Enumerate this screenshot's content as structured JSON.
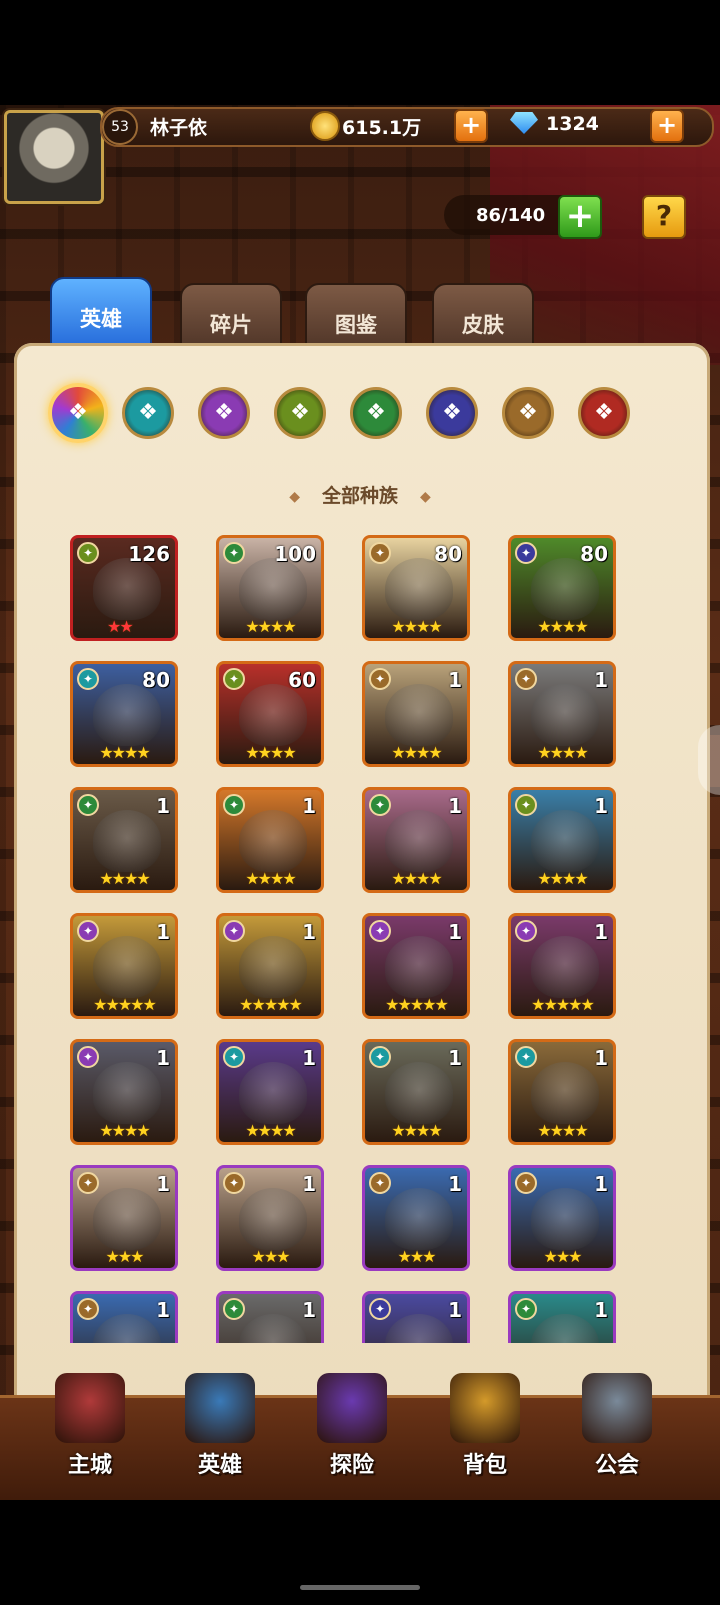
{
  "player": {
    "level": "53",
    "name": "林子依",
    "gold": "615.1万",
    "gems": "1324"
  },
  "hero_capacity": "86/140",
  "tabs": [
    {
      "label": "英雄",
      "active": true
    },
    {
      "label": "碎片",
      "active": false
    },
    {
      "label": "图鉴",
      "active": false
    },
    {
      "label": "皮肤",
      "active": false
    }
  ],
  "race_filters": [
    {
      "icon": "all-races-icon",
      "color": "#e24a3a",
      "selected": true
    },
    {
      "icon": "teal-race-icon",
      "color": "#1c9aa0",
      "selected": false
    },
    {
      "icon": "purple-race-icon",
      "color": "#8a3bb3",
      "selected": false
    },
    {
      "icon": "green-eye-race-icon",
      "color": "#6a8f1e",
      "selected": false
    },
    {
      "icon": "leaf-race-icon",
      "color": "#2d8a3a",
      "selected": false
    },
    {
      "icon": "demon-race-icon",
      "color": "#3b3a9c",
      "selected": false
    },
    {
      "icon": "light-race-icon",
      "color": "#9a6a2a",
      "selected": false
    },
    {
      "icon": "fire-race-icon",
      "color": "#b02a22",
      "selected": false
    }
  ],
  "race_title": "全部种族",
  "heroes": [
    {
      "level": "126",
      "race_color": "#6a8f1e",
      "frame": "#c02020",
      "bg": "#5a2a20",
      "stars": "★★",
      "red_stars": true
    },
    {
      "level": "100",
      "race_color": "#2d8a3a",
      "frame": "#d46a16",
      "bg": "#c9b3a6",
      "stars": "★★★★",
      "red_stars": false
    },
    {
      "level": "80",
      "race_color": "#9a6a2a",
      "frame": "#d46a16",
      "bg": "#e8d3a0",
      "stars": "★★★★",
      "red_stars": false
    },
    {
      "level": "80",
      "race_color": "#3b3a9c",
      "frame": "#d46a16",
      "bg": "#4f8a2a",
      "stars": "★★★★",
      "red_stars": false
    },
    {
      "level": "80",
      "race_color": "#1c9aa0",
      "frame": "#d46a16",
      "bg": "#3d5fa0",
      "stars": "★★★★",
      "red_stars": false
    },
    {
      "level": "60",
      "race_color": "#6a8f1e",
      "frame": "#d46a16",
      "bg": "#b8302a",
      "stars": "★★★★",
      "red_stars": false
    },
    {
      "level": "1",
      "race_color": "#9a6a2a",
      "frame": "#d46a16",
      "bg": "#b9a27a",
      "stars": "★★★★",
      "red_stars": false
    },
    {
      "level": "1",
      "race_color": "#9a6a2a",
      "frame": "#d46a16",
      "bg": "#7a7a7a",
      "stars": "★★★★",
      "red_stars": false
    },
    {
      "level": "1",
      "race_color": "#2d8a3a",
      "frame": "#d46a16",
      "bg": "#6a5a48",
      "stars": "★★★★",
      "red_stars": false
    },
    {
      "level": "1",
      "race_color": "#2d8a3a",
      "frame": "#d46a16",
      "bg": "#d4782a",
      "stars": "★★★★",
      "red_stars": false
    },
    {
      "level": "1",
      "race_color": "#2d8a3a",
      "frame": "#d46a16",
      "bg": "#a86a8a",
      "stars": "★★★★",
      "red_stars": false
    },
    {
      "level": "1",
      "race_color": "#6a8f1e",
      "frame": "#d46a16",
      "bg": "#3a7fa8",
      "stars": "★★★★",
      "red_stars": false
    },
    {
      "level": "1",
      "race_color": "#8a3bb3",
      "frame": "#d46a16",
      "bg": "#c49a3a",
      "stars": "★★★★★",
      "red_stars": false
    },
    {
      "level": "1",
      "race_color": "#8a3bb3",
      "frame": "#d46a16",
      "bg": "#c49a3a",
      "stars": "★★★★★",
      "red_stars": false
    },
    {
      "level": "1",
      "race_color": "#8a3bb3",
      "frame": "#d46a16",
      "bg": "#7a3a6a",
      "stars": "★★★★★",
      "red_stars": false
    },
    {
      "level": "1",
      "race_color": "#8a3bb3",
      "frame": "#d46a16",
      "bg": "#7a3a6a",
      "stars": "★★★★★",
      "red_stars": false
    },
    {
      "level": "1",
      "race_color": "#8a3bb3",
      "frame": "#d46a16",
      "bg": "#5a5a68",
      "stars": "★★★★",
      "red_stars": false
    },
    {
      "level": "1",
      "race_color": "#1c9aa0",
      "frame": "#d46a16",
      "bg": "#5a3a8a",
      "stars": "★★★★",
      "red_stars": false
    },
    {
      "level": "1",
      "race_color": "#1c9aa0",
      "frame": "#d46a16",
      "bg": "#6a6a5a",
      "stars": "★★★★",
      "red_stars": false
    },
    {
      "level": "1",
      "race_color": "#1c9aa0",
      "frame": "#d46a16",
      "bg": "#8a6a3a",
      "stars": "★★★★",
      "red_stars": false
    },
    {
      "level": "1",
      "race_color": "#9a6a2a",
      "frame": "#9a3ac0",
      "bg": "#b8a08a",
      "stars": "★★★",
      "red_stars": false
    },
    {
      "level": "1",
      "race_color": "#9a6a2a",
      "frame": "#9a3ac0",
      "bg": "#b8a08a",
      "stars": "★★★",
      "red_stars": false
    },
    {
      "level": "1",
      "race_color": "#9a6a2a",
      "frame": "#9a3ac0",
      "bg": "#3a6ab0",
      "stars": "★★★",
      "red_stars": false
    },
    {
      "level": "1",
      "race_color": "#9a6a2a",
      "frame": "#9a3ac0",
      "bg": "#3a6ab0",
      "stars": "★★★",
      "red_stars": false
    },
    {
      "level": "1",
      "race_color": "#9a6a2a",
      "frame": "#9a3ac0",
      "bg": "#3a6ab0",
      "stars": "★★★",
      "red_stars": false
    },
    {
      "level": "1",
      "race_color": "#2d8a3a",
      "frame": "#9a3ac0",
      "bg": "#6a6a6a",
      "stars": "★★★",
      "red_stars": false
    },
    {
      "level": "1",
      "race_color": "#3b3a9c",
      "frame": "#9a3ac0",
      "bg": "#4a4aa0",
      "stars": "★★★",
      "red_stars": false
    },
    {
      "level": "1",
      "race_color": "#2d8a3a",
      "frame": "#9a3ac0",
      "bg": "#2a8a8a",
      "stars": "★★★",
      "red_stars": false
    }
  ],
  "nav": [
    {
      "label": "主城",
      "icon": "castle-icon",
      "color": "#b03a3a"
    },
    {
      "label": "英雄",
      "icon": "hero-icon",
      "color": "#3a7ab8"
    },
    {
      "label": "探险",
      "icon": "portal-icon",
      "color": "#6a3ab0"
    },
    {
      "label": "背包",
      "icon": "backpack-icon",
      "color": "#d49a2a"
    },
    {
      "label": "公会",
      "icon": "guild-tower-icon",
      "color": "#7a8a9a"
    }
  ]
}
